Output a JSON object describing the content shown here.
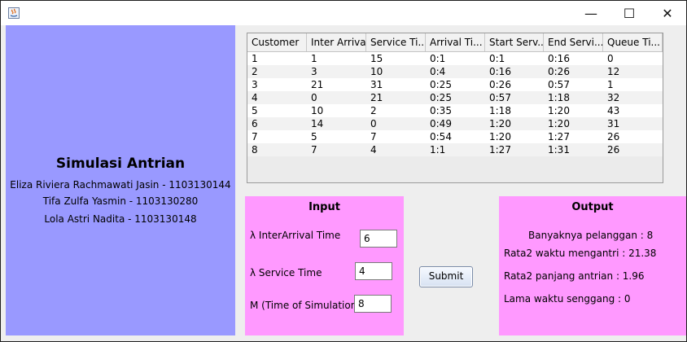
{
  "window": {
    "controls": {
      "minimize": "—",
      "maximize": "☐",
      "close": "✕"
    }
  },
  "left": {
    "title": "Simulasi Antrian",
    "authors": [
      "Eliza Riviera Rachmawati Jasin - 1103130144",
      "Tifa Zulfa Yasmin - 1103130280",
      "Lola Astri Nadita - 1103130148"
    ]
  },
  "table": {
    "columns": [
      "Customer",
      "Inter Arrival",
      "Service Ti...",
      "Arrival Ti...",
      "Start Serv...",
      "End Servi...",
      "Queue Ti..."
    ],
    "rows": [
      [
        "1",
        "1",
        "15",
        "0:1",
        "0:1",
        "0:16",
        "0"
      ],
      [
        "2",
        "3",
        "10",
        "0:4",
        "0:16",
        "0:26",
        "12"
      ],
      [
        "3",
        "21",
        "31",
        "0:25",
        "0:26",
        "0:57",
        "1"
      ],
      [
        "4",
        "0",
        "21",
        "0:25",
        "0:57",
        "1:18",
        "32"
      ],
      [
        "5",
        "10",
        "2",
        "0:35",
        "1:18",
        "1:20",
        "43"
      ],
      [
        "6",
        "14",
        "0",
        "0:49",
        "1:20",
        "1:20",
        "31"
      ],
      [
        "7",
        "5",
        "7",
        "0:54",
        "1:20",
        "1:27",
        "26"
      ],
      [
        "8",
        "7",
        "4",
        "1:1",
        "1:27",
        "1:31",
        "26"
      ]
    ]
  },
  "input": {
    "title": "Input",
    "interarrival_label": "λ InterArrival Time",
    "interarrival_value": "6",
    "service_label": "λ Service Time",
    "service_value": "4",
    "simulation_label": "M (Time of Simulation)",
    "simulation_value": "8"
  },
  "submit_label": "Submit",
  "output": {
    "title": "Output",
    "customers": "Banyaknya pelanggan : 8",
    "avg_wait": "Rata2 waktu mengantri : 21.38",
    "avg_queue": "Rata2 panjang antrian : 1.96",
    "idle_time": "Lama waktu senggang : 0"
  },
  "colors": {
    "left_panel": "#9999ff",
    "io_panels": "#ff99ff",
    "background": "#eeeeee"
  }
}
